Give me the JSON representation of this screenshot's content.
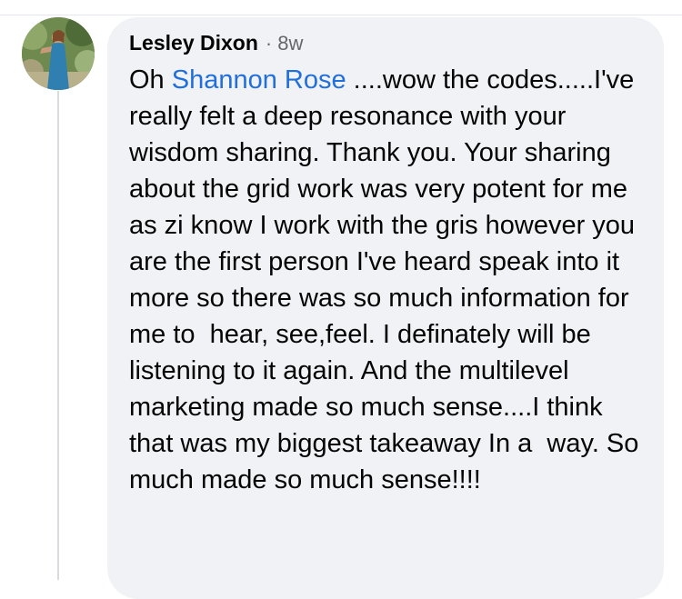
{
  "comment": {
    "author": "Lesley Dixon",
    "separator": "·",
    "timestamp": "8w",
    "mention": "Shannon Rose",
    "text_prefix": "Oh ",
    "text_body": " ....wow the codes.....I've really felt a deep resonance with your wisdom sharing. Thank you. Your sharing about the grid work was very potent for me as zi know I work with the gris however you are the first person I've heard speak into it more so there was so much information for me to  hear, see,feel. I definately will be listening to it again. And the multilevel marketing made so much sense....I think that was my biggest takeaway In a  way. So much made so much sense!!!!"
  },
  "avatar": {
    "icon": "profile-photo-icon"
  },
  "colors": {
    "bubble_background": "#f0f2f5",
    "mention": "#216fdb",
    "text": "#050505",
    "secondary_text": "#65676b",
    "thread_line": "#d8dadf"
  }
}
